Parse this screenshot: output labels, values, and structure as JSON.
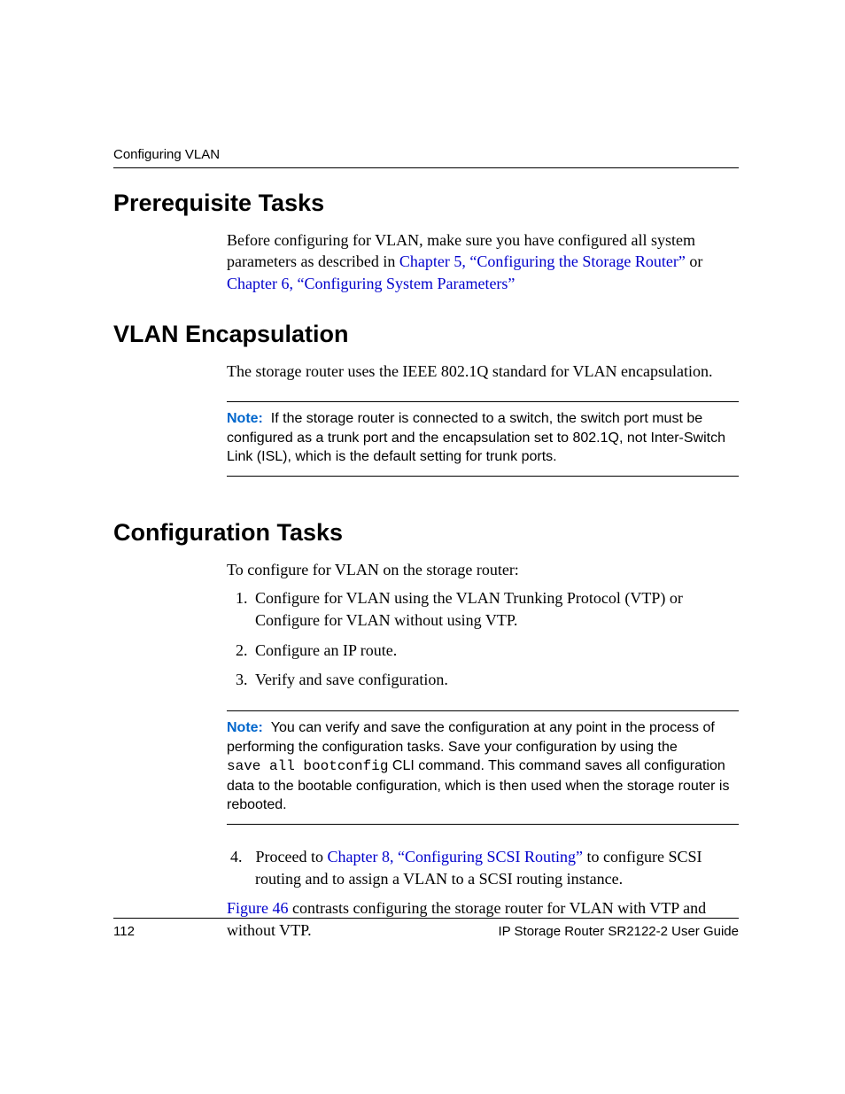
{
  "header": {
    "running_title": "Configuring VLAN"
  },
  "sections": {
    "prereq": {
      "heading": "Prerequisite Tasks",
      "p1_before": "Before configuring for VLAN, make sure you have configured all system parameters as described in ",
      "p1_link1": "Chapter 5, “Configuring the Storage Router”",
      "p1_mid": " or ",
      "p1_link2": "Chapter 6, “Configuring System Parameters”"
    },
    "vlan_encap": {
      "heading": "VLAN Encapsulation",
      "p1": "The storage router uses the IEEE 802.1Q standard for VLAN encapsulation.",
      "note_label": "Note:",
      "note_body": "If the storage router is connected to a switch, the switch port must be configured as a trunk port and the encapsulation set to 802.1Q, not Inter-Switch Link (ISL), which is the default setting for trunk ports."
    },
    "config_tasks": {
      "heading": "Configuration Tasks",
      "intro": "To configure for VLAN on the storage router:",
      "step1": "Configure for VLAN using the VLAN Trunking Protocol (VTP) or Configure for VLAN without using VTP.",
      "step2": "Configure an IP route.",
      "step3": "Verify and save configuration.",
      "note_label": "Note:",
      "note_body_before": "You can verify and save the configuration at any point in the process of performing the configuration tasks. Save your configuration by using the ",
      "note_cmd": "save all bootconfig",
      "note_body_after": " CLI command. This command saves all configuration data to the bootable configuration, which is then used when the storage router is rebooted.",
      "step4_before": "Proceed to ",
      "step4_link": "Chapter 8, “Configuring SCSI Routing”",
      "step4_after": " to configure SCSI routing and to assign a VLAN to a SCSI routing instance.",
      "closing_link": "Figure 46",
      "closing_after": " contrasts configuring the storage router for VLAN with VTP and without VTP."
    }
  },
  "footer": {
    "page_number": "112",
    "doc_title": "IP Storage Router SR2122-2 User Guide"
  }
}
